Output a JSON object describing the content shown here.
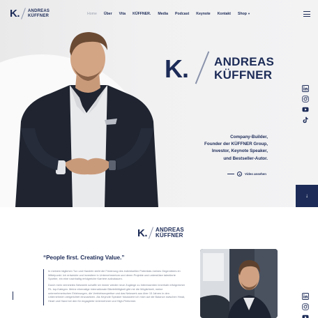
{
  "brand": {
    "logo_initial": "K.",
    "logo_name_line1": "ANDREAS",
    "logo_name_line2": "KÜFFNER"
  },
  "nav": {
    "items": [
      {
        "label": "Home",
        "active": true
      },
      {
        "label": "Über"
      },
      {
        "label": "Vita"
      },
      {
        "label": "KÜFFNER."
      },
      {
        "label": "Media"
      },
      {
        "label": "Podcast"
      },
      {
        "label": "Keynote"
      },
      {
        "label": "Kontakt"
      },
      {
        "label": "Shop",
        "dropdown": true
      }
    ],
    "menu_icon": "hamburger-menu-icon"
  },
  "hero": {
    "initial": "K.",
    "name_line1": "ANDREAS",
    "name_line2": "KÜFFNER",
    "tagline": [
      "Company-Builder,",
      "Founder der KÜFFNER Group,",
      "Investor, Keynote Speaker,",
      "und Bestseller-Autor."
    ],
    "video_label": "Video ansehen",
    "scroll_icon": "arrow-down-icon"
  },
  "social": [
    "linkedin-icon",
    "instagram-icon",
    "youtube-icon",
    "tiktok-icon"
  ],
  "intro": {
    "logo_initial": "K.",
    "logo_name_line1": "ANDREAS",
    "logo_name_line2": "KÜFFNER",
    "quote": "“People first. Creating Value.”",
    "paragraphs": [
      "In meinem täglichen Tun und Handeln steht die Förderung des individuellen Potentials meines Gegenübers im Mittelpunkt. Ich entwickle und investiere in Unternehmertum und deren Projekte und unterstütze talentierte Sportler, ein eine nachhaltig erfolgreiche Karriere aufzubauen.",
      "Durch mein vernetztes Netzwerk schaffe ich immer wieder neue Zugänge zu Interessenten innerhalb erfolgreicher Fit- top-Kategen. Meine ehemalige internationale Bikelethlitigkeit gibt mir die Möglichkeit, meine unternehmerischen Erfahrungen, die Vertriebsexpertise und das Netzwerk aus über 15 Jahren in den Unternehmen zielgerichtet einzusetzen. Als Keynote Speaker fokussiere ich mich auf die Balance zwischen Head, Heart und Hand bei den für engagierte Unternehmer und High-Performer."
    ]
  },
  "colors": {
    "primary": "#1c2b57",
    "muted": "#9aa0ae",
    "hero_bg": "#efefef"
  }
}
